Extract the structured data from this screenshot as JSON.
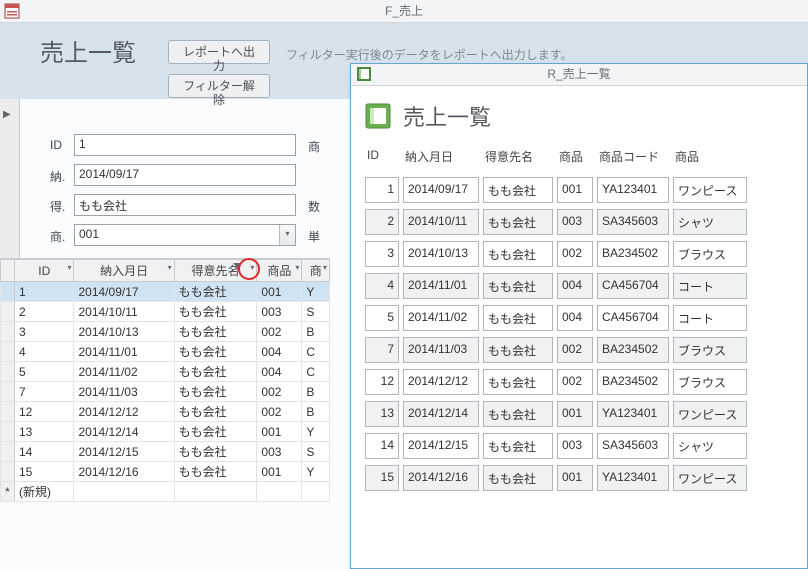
{
  "window": {
    "title": "F_売上"
  },
  "form": {
    "title": "売上一覧",
    "buttons": {
      "report": "レポートへ出力",
      "clear_filter": "フィルター解除"
    },
    "helper": "フィルター実行後のデータをレポートへ出力します。",
    "labels": {
      "id": "ID",
      "date": "納.",
      "cust": "得.",
      "prod": "商.",
      "right1": "商",
      "right2": "数",
      "right3": "単"
    },
    "values": {
      "id": "1",
      "date": "2014/09/17",
      "cust": "もも会社",
      "prod": "001"
    }
  },
  "datasheet": {
    "columns": [
      "ID",
      "納入月日",
      "得意先名",
      "商品",
      "商"
    ],
    "filtered_column_index": 2,
    "rows": [
      {
        "sel": true,
        "id": "1",
        "date": "2014/09/17",
        "cust": "もも会社",
        "prod": "001",
        "r": "Y"
      },
      {
        "sel": false,
        "id": "2",
        "date": "2014/10/11",
        "cust": "もも会社",
        "prod": "003",
        "r": "S"
      },
      {
        "sel": false,
        "id": "3",
        "date": "2014/10/13",
        "cust": "もも会社",
        "prod": "002",
        "r": "B"
      },
      {
        "sel": false,
        "id": "4",
        "date": "2014/11/01",
        "cust": "もも会社",
        "prod": "004",
        "r": "C"
      },
      {
        "sel": false,
        "id": "5",
        "date": "2014/11/02",
        "cust": "もも会社",
        "prod": "004",
        "r": "C"
      },
      {
        "sel": false,
        "id": "7",
        "date": "2014/11/03",
        "cust": "もも会社",
        "prod": "002",
        "r": "B"
      },
      {
        "sel": false,
        "id": "12",
        "date": "2014/12/12",
        "cust": "もも会社",
        "prod": "002",
        "r": "B"
      },
      {
        "sel": false,
        "id": "13",
        "date": "2014/12/14",
        "cust": "もも会社",
        "prod": "001",
        "r": "Y"
      },
      {
        "sel": false,
        "id": "14",
        "date": "2014/12/15",
        "cust": "もも会社",
        "prod": "003",
        "r": "S"
      },
      {
        "sel": false,
        "id": "15",
        "date": "2014/12/16",
        "cust": "もも会社",
        "prod": "001",
        "r": "Y"
      }
    ],
    "newrow_label": "(新規)"
  },
  "report": {
    "window_title": "R_売上一覧",
    "title": "売上一覧",
    "columns": [
      "ID",
      "納入月日",
      "得意先名",
      "商品",
      "商品コード",
      "商品"
    ],
    "rows": [
      {
        "grey": false,
        "id": "1",
        "date": "2014/09/17",
        "cust": "もも会社",
        "prod": "001",
        "code": "YA123401",
        "name": "ワンピース"
      },
      {
        "grey": true,
        "id": "2",
        "date": "2014/10/11",
        "cust": "もも会社",
        "prod": "003",
        "code": "SA345603",
        "name": "シャツ"
      },
      {
        "grey": false,
        "id": "3",
        "date": "2014/10/13",
        "cust": "もも会社",
        "prod": "002",
        "code": "BA234502",
        "name": "ブラウス"
      },
      {
        "grey": true,
        "id": "4",
        "date": "2014/11/01",
        "cust": "もも会社",
        "prod": "004",
        "code": "CA456704",
        "name": "コート"
      },
      {
        "grey": false,
        "id": "5",
        "date": "2014/11/02",
        "cust": "もも会社",
        "prod": "004",
        "code": "CA456704",
        "name": "コート"
      },
      {
        "grey": true,
        "id": "7",
        "date": "2014/11/03",
        "cust": "もも会社",
        "prod": "002",
        "code": "BA234502",
        "name": "ブラウス"
      },
      {
        "grey": false,
        "id": "12",
        "date": "2014/12/12",
        "cust": "もも会社",
        "prod": "002",
        "code": "BA234502",
        "name": "ブラウス"
      },
      {
        "grey": true,
        "id": "13",
        "date": "2014/12/14",
        "cust": "もも会社",
        "prod": "001",
        "code": "YA123401",
        "name": "ワンピース"
      },
      {
        "grey": false,
        "id": "14",
        "date": "2014/12/15",
        "cust": "もも会社",
        "prod": "003",
        "code": "SA345603",
        "name": "シャツ"
      },
      {
        "grey": true,
        "id": "15",
        "date": "2014/12/16",
        "cust": "もも会社",
        "prod": "001",
        "code": "YA123401",
        "name": "ワンピース"
      }
    ]
  }
}
